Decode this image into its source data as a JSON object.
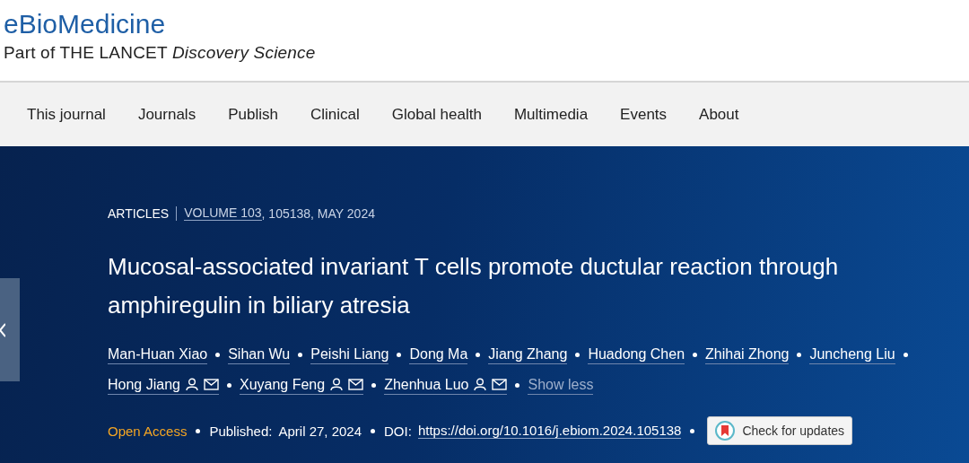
{
  "journal": {
    "name": "eBioMedicine",
    "subtitle_prefix": "Part of THE LANCET",
    "subtitle_italic": "Discovery Science"
  },
  "nav": [
    "This journal",
    "Journals",
    "Publish",
    "Clinical",
    "Global health",
    "Multimedia",
    "Events",
    "About"
  ],
  "article": {
    "type": "ARTICLES",
    "volume": "VOLUME 103",
    "issue": ", 105138, MAY 2024",
    "title": "Mucosal-associated invariant T cells promote ductular reaction through amphiregulin in biliary atresia",
    "authors": [
      {
        "name": "Man-Huan Xiao",
        "corresponding": false
      },
      {
        "name": "Sihan Wu",
        "corresponding": false
      },
      {
        "name": "Peishi Liang",
        "corresponding": false
      },
      {
        "name": "Dong Ma",
        "corresponding": false
      },
      {
        "name": "Jiang Zhang",
        "corresponding": false
      },
      {
        "name": "Huadong Chen",
        "corresponding": false
      },
      {
        "name": "Zhihai Zhong",
        "corresponding": false
      },
      {
        "name": "Juncheng Liu",
        "corresponding": false
      },
      {
        "name": "Hong Jiang",
        "corresponding": true
      },
      {
        "name": "Xuyang Feng",
        "corresponding": true
      },
      {
        "name": "Zhenhua Luo",
        "corresponding": true
      }
    ],
    "show_less": "Show less",
    "access": "Open Access",
    "published_label": "Published:",
    "published_date": "April 27, 2024",
    "doi_label": "DOI:",
    "doi": "https://doi.org/10.1016/j.ebiom.2024.105138",
    "updates_button": "Check for updates"
  }
}
